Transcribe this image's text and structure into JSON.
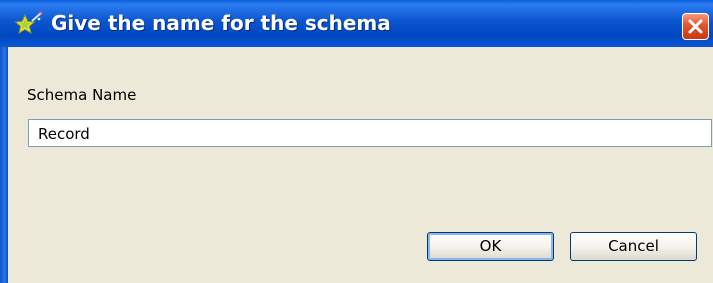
{
  "dialog": {
    "title": "Give the name for the schema",
    "title_icon": "star-wand-icon",
    "close_icon": "close-x-icon",
    "accent_titlebar": "#0a55cf",
    "close_color": "#e2542c"
  },
  "form": {
    "label": "Schema Name",
    "value": "Record"
  },
  "buttons": {
    "ok_label": "OK",
    "cancel_label": "Cancel"
  }
}
